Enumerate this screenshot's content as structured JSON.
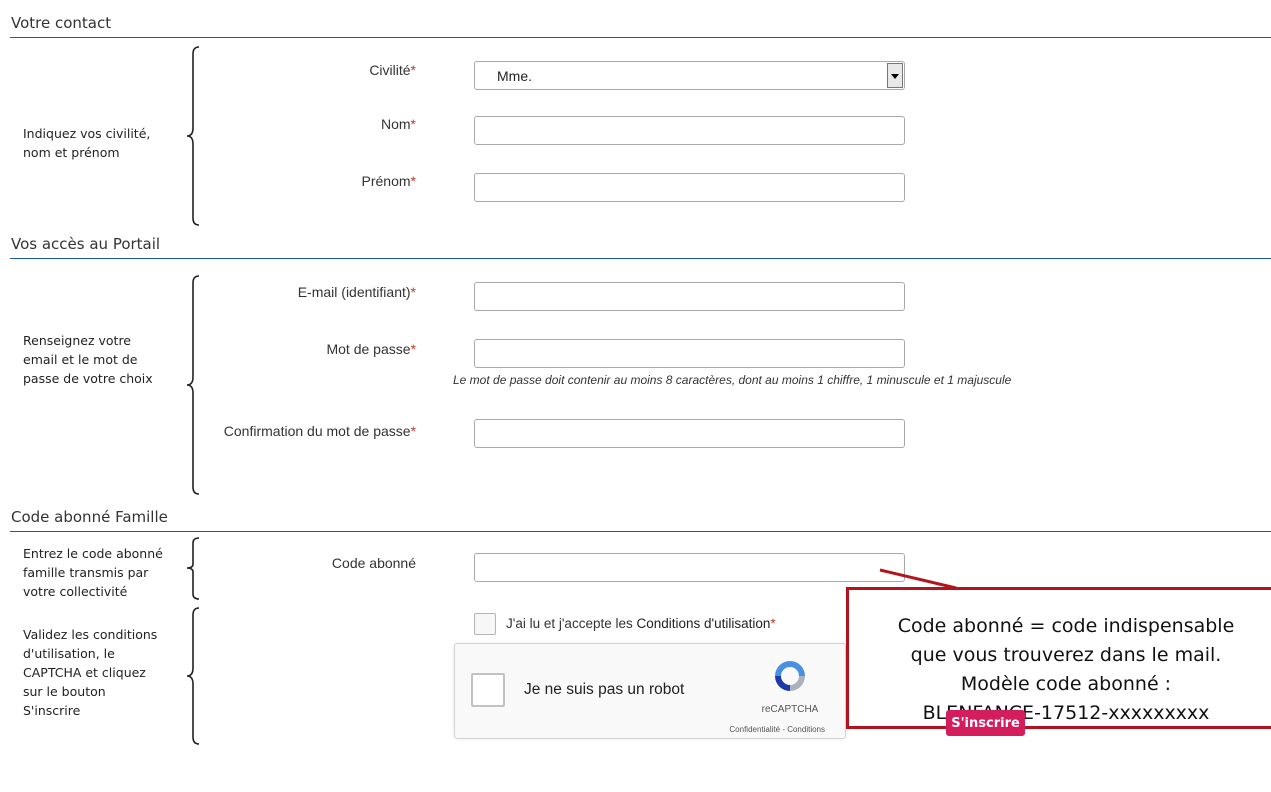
{
  "sections": {
    "contact": {
      "title": "Votre contact",
      "hint": "Indiquez vos civilité,\nnom et prénom"
    },
    "access": {
      "title": "Vos accès au Portail",
      "hint": "Renseignez votre\nemail et le mot de\npasse de votre choix"
    },
    "code": {
      "title": "Code abonné Famille",
      "hint": "Entrez le code abonné\nfamille transmis par\nvotre collectivité"
    },
    "validate": {
      "hint": "Validez les conditions\nd'utilisation, le\nCAPTCHA et cliquez\nsur le bouton\nS'inscrire"
    }
  },
  "fields": {
    "civilite": {
      "label": "Civilité",
      "value": "Mme."
    },
    "nom": {
      "label": "Nom",
      "value": ""
    },
    "prenom": {
      "label": "Prénom",
      "value": ""
    },
    "email": {
      "label": "E-mail (identifiant)",
      "value": ""
    },
    "password": {
      "label": "Mot de passe",
      "value": ""
    },
    "password_hint": "Le mot de passe doit contenir au moins 8 caractères, dont au moins 1 chiffre, 1 minuscule et 1 majuscule",
    "password_confirm": {
      "label": "Confirmation du mot de passe",
      "value": ""
    },
    "code_abonne": {
      "label": "Code abonné",
      "value": ""
    }
  },
  "required_marker": "*",
  "terms": {
    "prefix": "J'ai lu et j'accepte les ",
    "link": "Conditions d'utilisation",
    "checked": false
  },
  "recaptcha": {
    "label": "Je ne suis pas un robot",
    "brand": "reCAPTCHA",
    "links": "Confidentialité - Conditions"
  },
  "callout": {
    "lines": [
      "Code abonné = code indispensable",
      "que vous trouverez dans le mail.",
      "Modèle code abonné :",
      "BLENFANCE-17512-xxxxxxxxx"
    ]
  },
  "submit_label": "S'inscrire",
  "colors": {
    "accent_rule": "#1f5a9c",
    "required": "#c0392b",
    "button": "#d41d5c",
    "callout_border": "#b2131c"
  }
}
